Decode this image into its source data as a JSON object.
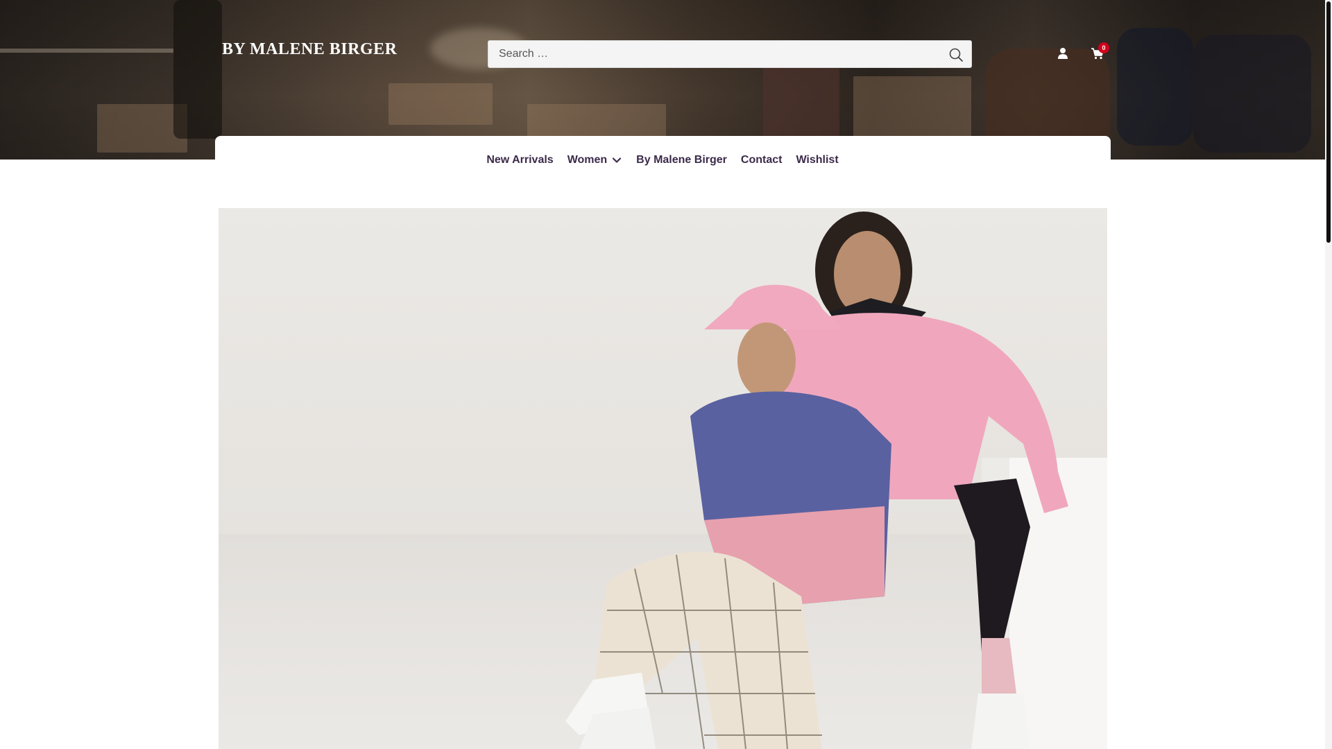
{
  "brand": {
    "logo_text": "BY MALENE BIRGER"
  },
  "search": {
    "placeholder": "Search …",
    "icon": "search-icon"
  },
  "header": {
    "account_icon": "user-icon",
    "cart_icon": "cart-icon",
    "cart_count": "0"
  },
  "nav": {
    "items": [
      {
        "label": "New Arrivals"
      },
      {
        "label": "Women",
        "has_dropdown": true
      },
      {
        "label": "By Malene Birger"
      },
      {
        "label": "Contact"
      },
      {
        "label": "Wishlist"
      }
    ]
  },
  "colors": {
    "nav_text": "#3b2a4a",
    "cart_badge": "#d0021b",
    "search_bg": "#f4f4f4"
  }
}
